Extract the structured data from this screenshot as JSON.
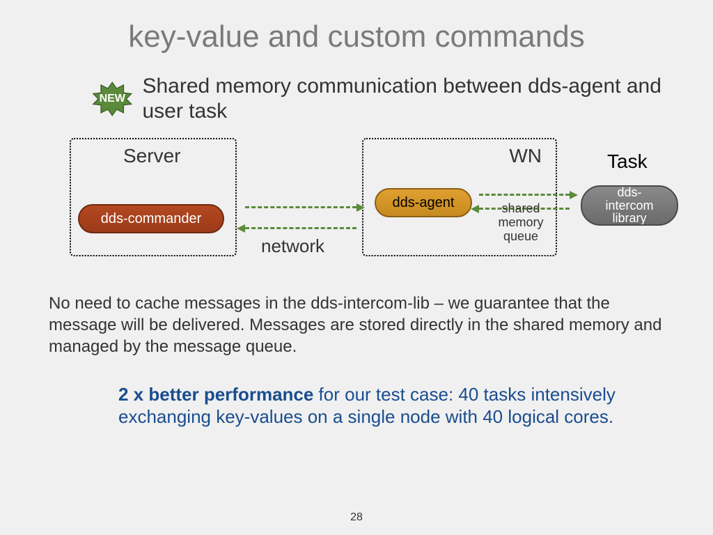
{
  "title": "key-value and custom commands",
  "badge": {
    "text": "NEW"
  },
  "subtitle": "Shared memory communication between dds-agent and user task",
  "diagram": {
    "server_label": "Server",
    "wn_label": "WN",
    "task_label": "Task",
    "commander": "dds-commander",
    "agent": "dds-agent",
    "intercom_line1": "dds-",
    "intercom_line2": "intercom",
    "intercom_line3": "library",
    "network": "network",
    "smq_line1": "shared",
    "smq_line2": "memory",
    "smq_line3": "queue"
  },
  "paragraph": "No need to cache messages in the dds-intercom-lib – we guarantee that the message will be delivered. Messages are stored directly in the shared memory and managed by the message queue.",
  "highlight_bold": "2 x better performance",
  "highlight_rest": " for our test case: 40 tasks intensively exchanging key-values on a single node with 40 logical cores.",
  "page_number": "28"
}
